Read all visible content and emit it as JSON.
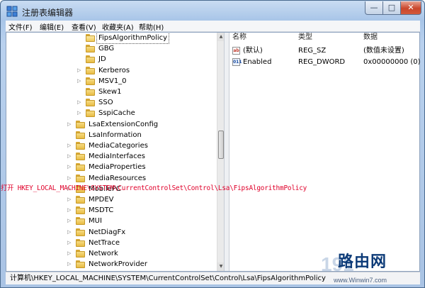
{
  "window": {
    "title": "注册表编辑器",
    "controls": {
      "minimize": "—",
      "maximize": "□",
      "close": "✕"
    }
  },
  "menu": [
    "文件(F)",
    "编辑(E)",
    "查看(V)",
    "收藏夹(A)",
    "帮助(H)"
  ],
  "tree": {
    "items": [
      {
        "label": "FipsAlgorithmPolicy",
        "expander": "",
        "selected": true
      },
      {
        "label": "GBG",
        "expander": ""
      },
      {
        "label": "JD",
        "expander": ""
      },
      {
        "label": "Kerberos",
        "expander": "▷"
      },
      {
        "label": "MSV1_0",
        "expander": "▷"
      },
      {
        "label": "Skew1",
        "expander": ""
      },
      {
        "label": "SSO",
        "expander": "▷"
      },
      {
        "label": "SspiCache",
        "expander": "▷"
      },
      {
        "label": "LsaExtensionConfig",
        "expander": "▷"
      },
      {
        "label": "LsaInformation",
        "expander": ""
      },
      {
        "label": "MediaCategories",
        "expander": "▷"
      },
      {
        "label": "MediaInterfaces",
        "expander": "▷"
      },
      {
        "label": "MediaProperties",
        "expander": "▷"
      },
      {
        "label": "MediaResources",
        "expander": "▷"
      },
      {
        "label": "MobilePC",
        "expander": "▷"
      },
      {
        "label": "MPDEV",
        "expander": "▷"
      },
      {
        "label": "MSDTC",
        "expander": "▷"
      },
      {
        "label": "MUI",
        "expander": "▷"
      },
      {
        "label": "NetDiagFx",
        "expander": "▷"
      },
      {
        "label": "NetTrace",
        "expander": "▷"
      },
      {
        "label": "Network",
        "expander": "▷"
      },
      {
        "label": "NetworkProvider",
        "expander": "▷"
      }
    ]
  },
  "list": {
    "columns": {
      "name": "名称",
      "type": "类型",
      "data": "数据"
    },
    "rows": [
      {
        "icon": "ab",
        "name": "(默认)",
        "type": "REG_SZ",
        "data": "(数值未设置)"
      },
      {
        "icon": "011",
        "name": "Enabled",
        "type": "REG_DWORD",
        "data": "0x00000000 (0)"
      }
    ]
  },
  "status": "计算机\\HKEY_LOCAL_MACHINE\\SYSTEM\\CurrentControlSet\\Control\\Lsa\\FipsAlgorithmPolicy",
  "annotation": "打开 HKEY_LOCAL_MACHINE\\SYSTEM\\CurrentControlSet\\Control\\Lsa\\FipsAlgorithmPolicy",
  "watermark": {
    "main": "路由网",
    "sub": "www.Winwin7.com",
    "logo": "191"
  },
  "colors": {
    "annotation": "#e0002a",
    "watermark": "#0d3b78"
  }
}
